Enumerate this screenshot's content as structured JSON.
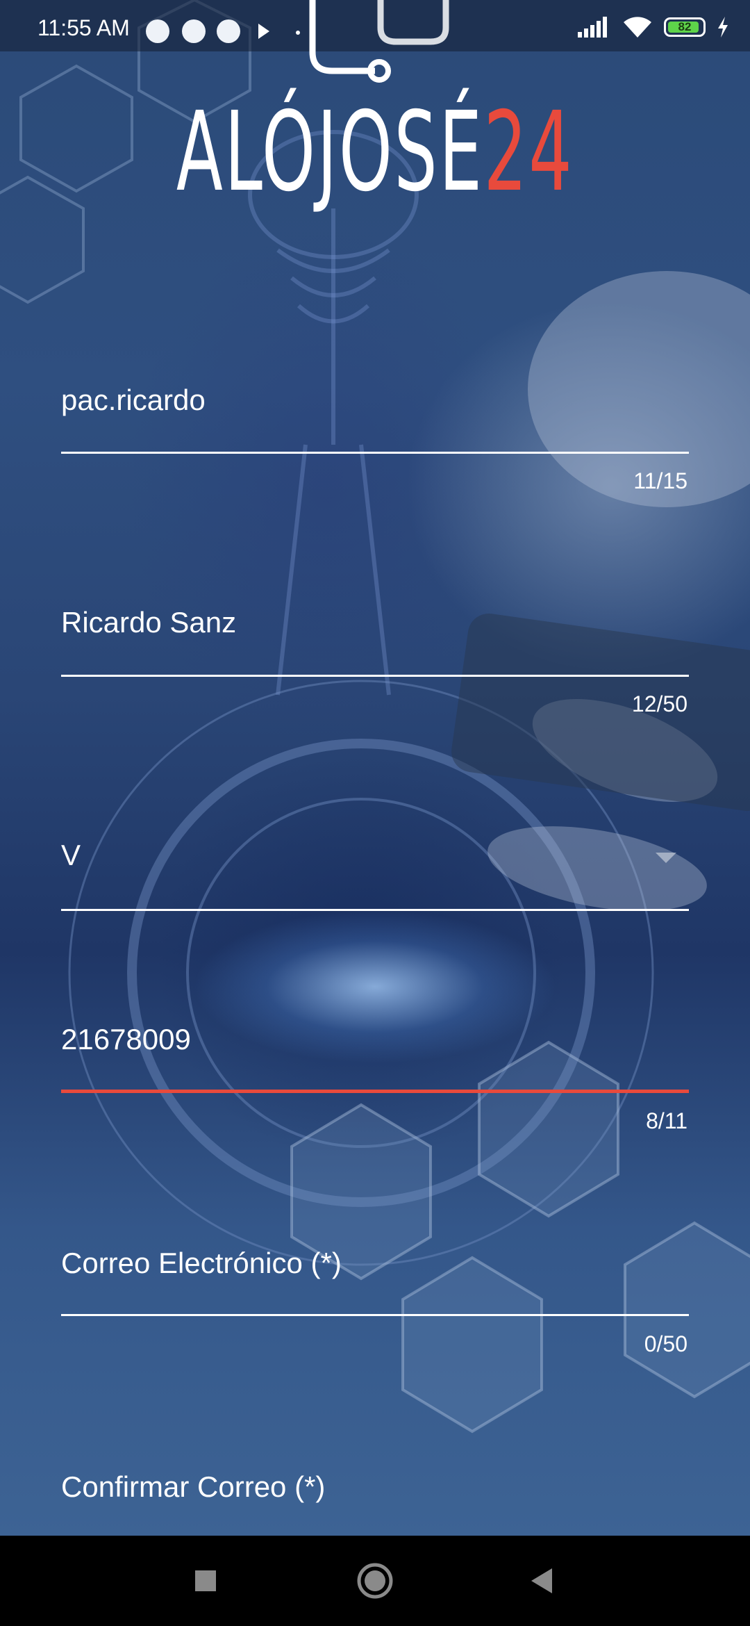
{
  "status_bar": {
    "time": "11:55 AM",
    "battery_level": "82",
    "icons": [
      "alarm-icon",
      "notification-app-icon",
      "sync-app-icon",
      "play-store-icon",
      "dot-icon",
      "signal-icon",
      "wifi-icon",
      "battery-icon",
      "charging-icon"
    ]
  },
  "logo": {
    "main": "ALÓJOSÉ",
    "accent": "24",
    "accent_color": "#e84a3c"
  },
  "form": {
    "username": {
      "value": "pac.ricardo",
      "counter": "11/15"
    },
    "full_name": {
      "value": "Ricardo Sanz",
      "counter": "12/50"
    },
    "id_type": {
      "value": "V"
    },
    "id_number": {
      "value": "21678009",
      "counter": "8/11"
    },
    "email": {
      "placeholder": "Correo Electrónico (*)",
      "counter": "0/50"
    },
    "confirm_email": {
      "placeholder": "Confirmar Correo (*)"
    }
  },
  "colors": {
    "accent": "#e84a3c",
    "text": "#ffffff"
  },
  "nav_bar": {
    "buttons": [
      "recents-square-icon",
      "home-circle-icon",
      "back-triangle-icon"
    ]
  }
}
